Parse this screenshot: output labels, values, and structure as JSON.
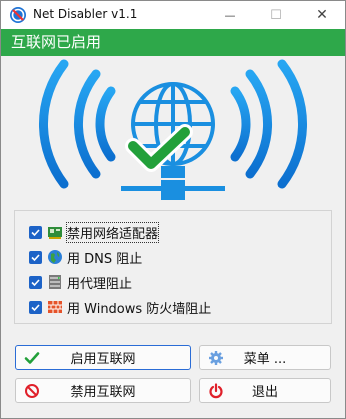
{
  "window": {
    "title": "Net Disabler v1.1",
    "minimize_glyph": "—",
    "maximize_glyph": "☐",
    "close_glyph": "✕"
  },
  "status": {
    "text": "互联网已启用",
    "color": "#2ea84a"
  },
  "illustration": {
    "icon": "globe-wifi-check-icon",
    "wave_color": "#1a8fe0",
    "check_color": "#22a03a"
  },
  "options": [
    {
      "label": "禁用网络适配器",
      "checked": true,
      "icon": "network-card-icon"
    },
    {
      "label": "用 DNS 阻止",
      "checked": true,
      "icon": "globe-icon"
    },
    {
      "label": "用代理阻止",
      "checked": true,
      "icon": "server-icon"
    },
    {
      "label": "用 Windows 防火墙阻止",
      "checked": true,
      "icon": "firewall-icon"
    }
  ],
  "buttons": {
    "enable": {
      "label": "启用互联网",
      "icon": "check-icon"
    },
    "menu": {
      "label": "菜单 ...",
      "icon": "gear-icon"
    },
    "disable": {
      "label": "禁用互联网",
      "icon": "prohibit-icon"
    },
    "exit": {
      "label": "退出",
      "icon": "power-icon"
    }
  },
  "colors": {
    "accent_blue": "#1d63c7",
    "focus_border": "#2a6cd6"
  }
}
